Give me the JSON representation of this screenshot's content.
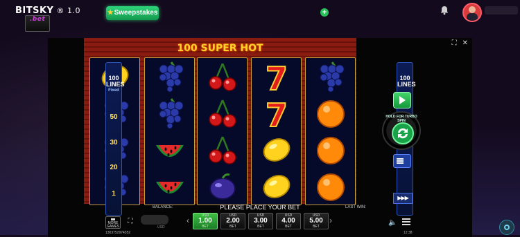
{
  "header": {
    "logo_text": "BITSKY",
    "logo_sub": ".bet",
    "version": "® 1.0",
    "sweepstakes_label": "Sweepstakes",
    "add_label": "+"
  },
  "game": {
    "title": "100 SUPER HOT",
    "window_controls": [
      "⛶",
      "✕"
    ],
    "reels": [
      [
        "lemon",
        "grapes",
        "grapes",
        "grapes"
      ],
      [
        "grapes",
        "grapes",
        "watermelon",
        "watermelon"
      ],
      [
        "cherries",
        "cherries",
        "cherries",
        "plum"
      ],
      [
        "seven",
        "seven",
        "lemon",
        "lemon"
      ],
      [
        "grapes",
        "orange",
        "orange",
        "orange"
      ]
    ],
    "lines_left": {
      "top_value": "100",
      "top_label": "LINES",
      "top_sub": "Fixed",
      "markers": [
        "50",
        "30",
        "20",
        "1"
      ]
    },
    "lines_right": {
      "top_value": "100",
      "top_label": "LINES"
    },
    "turbo_label": "HOLD FOR TURBO SPIN",
    "speed_label": "▶▶▶",
    "status_text": "PLEASE PLACE YOUR BET",
    "balance_label": "BALANCE:",
    "last_win_label": "LAST WIN:",
    "blurred_label": "USD",
    "more_games_label": "MORE GAMES",
    "bets": [
      {
        "currency": "USD",
        "value": "1.00",
        "label": "BET",
        "selected": true
      },
      {
        "currency": "USD",
        "value": "2.00",
        "label": "BET",
        "selected": false
      },
      {
        "currency": "USD",
        "value": "3.00",
        "label": "BET",
        "selected": false
      },
      {
        "currency": "USD",
        "value": "4.00",
        "label": "BET",
        "selected": false
      },
      {
        "currency": "USD",
        "value": "5.00",
        "label": "BET",
        "selected": false
      }
    ],
    "arrow_left": "‹",
    "arrow_right": "›",
    "session_id": "1303752974352",
    "time": "12:38"
  },
  "colors": {
    "accent_green": "#1fb45a",
    "board_red": "#8a1b10",
    "title_gold": "#ffd22b"
  }
}
